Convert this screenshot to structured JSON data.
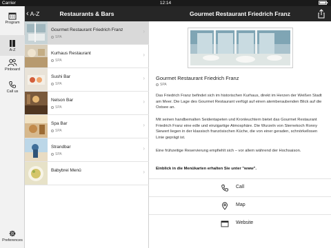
{
  "status_bar": {
    "carrier": "Carrier",
    "time": "12:14"
  },
  "header": {
    "back_label": "A-Z",
    "list_title": "Restaurants & Bars",
    "detail_title": "Gourmet Restaurant Friedrich Franz"
  },
  "tab_rail": {
    "items": [
      {
        "label": "Program",
        "icon": "calendar-icon"
      },
      {
        "label": "A-Z",
        "icon": "book-icon"
      },
      {
        "label": "Pinboard",
        "icon": "people-icon"
      },
      {
        "label": "Call us",
        "icon": "phone-icon"
      },
      {
        "label": "Preferences",
        "icon": "gear-icon"
      }
    ]
  },
  "list": {
    "items": [
      {
        "title": "Gourmet Restaurant Friedrich Franz",
        "sub": "SPA",
        "selected": true
      },
      {
        "title": "Kurhaus Restaurant",
        "sub": "SPA"
      },
      {
        "title": "Sushi Bar",
        "sub": "SPA"
      },
      {
        "title": "Nelson Bar",
        "sub": "SPA"
      },
      {
        "title": "Spa Bar",
        "sub": "SPA"
      },
      {
        "title": "Strandbar",
        "sub": "SPA"
      },
      {
        "title": "Babybrei Menü",
        "sub": ""
      }
    ]
  },
  "detail": {
    "title": "Gourmet Restaurant Friedrich Franz",
    "location": "SPA",
    "paragraph1": "Das Friedrich Franz befindet sich im historischen Kurhaus, direkt im Herzen der Weißen Stadt am Meer. Die Lage des Gourmet Restaurant verfügt auf einen atemberaubenden Blick auf die Ostsee an.",
    "paragraph2": "Mit seinen handbemalten Seidentapeten und Kronleuchtern bietet das Gourmet Restaurant Friedrich Franz eine edle und einzigartige Atmosphäre. Die Wurzeln von Sternekoch Ronny Siewert liegen in der klassisch französischen Küche, die von einer geraden, schnörkellosen Linie geprägt ist.",
    "paragraph3": "Eine frühzeitige Reservierung empfiehlt sich – vor allem während der Hochsaison.",
    "paragraph4": "Einblick in die Menükarten erhalten Sie unter \"www\".",
    "actions": [
      {
        "label": "Call",
        "icon": "phone-icon"
      },
      {
        "label": "Map",
        "icon": "map-pin-icon"
      },
      {
        "label": "Website",
        "icon": "browser-icon"
      }
    ]
  }
}
